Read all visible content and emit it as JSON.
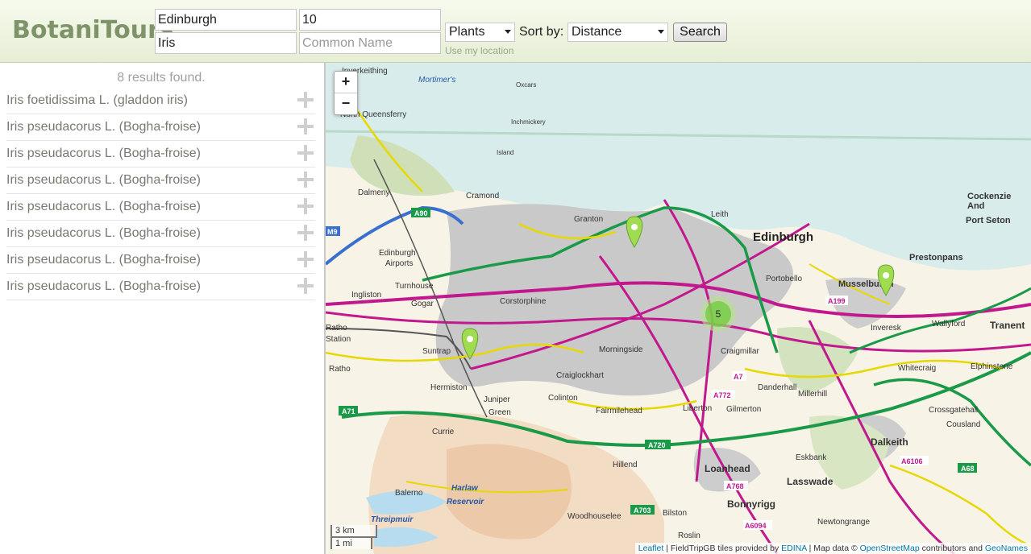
{
  "header": {
    "logo": "BotaniTours",
    "location_value": "Edinburgh",
    "radius_value": "10",
    "species_value": "Iris",
    "common_name_placeholder": "Common Name",
    "category_value": "Plants",
    "sort_label": "Sort by:",
    "sort_value": "Distance",
    "search_label": "Search",
    "use_location_label": "Use my location"
  },
  "results": {
    "count_text": "8 results found.",
    "items": [
      "Iris foetidissima L. (gladdon iris)",
      "Iris pseudacorus L. (Bogha-froise)",
      "Iris pseudacorus L. (Bogha-froise)",
      "Iris pseudacorus L. (Bogha-froise)",
      "Iris pseudacorus L. (Bogha-froise)",
      "Iris pseudacorus L. (Bogha-froise)",
      "Iris pseudacorus L. (Bogha-froise)",
      "Iris pseudacorus L. (Bogha-froise)"
    ]
  },
  "map": {
    "zoom_in": "+",
    "zoom_out": "−",
    "cluster_count": "5",
    "scale_km": "3 km",
    "scale_mi": "1 mi",
    "attribution": {
      "leaflet": "Leaflet",
      "part1": " | FieldTripGB tiles provided by ",
      "edina": "EDINA",
      "part2": " | Map data © ",
      "osm": "OpenStreetMap",
      "part3": " contributors and ",
      "geonames": "GeoNames"
    },
    "place_labels": {
      "inverkeithing": "Inverkeithing",
      "north_queensferry": "North Queensferry",
      "dalmeny": "Dalmeny",
      "cramond": "Cramond",
      "granton": "Granton",
      "leith": "Leith",
      "edinburgh": "Edinburgh",
      "cockenzie": "Cockenzie",
      "and": "And",
      "port_seton": "Port Seton",
      "prestonpans": "Prestonpans",
      "musselburgh": "Musselburgh",
      "edinburgh_airport": "Edinburgh",
      "airports": "Airports",
      "ratho_station": "Ratho",
      "station": "Station",
      "corstorphine": "Corstorphine",
      "morningside": "Morningside",
      "craigmillar": "Craigmillar",
      "craiglockhart": "Craiglockhart",
      "colinton": "Colinton",
      "fairmilehead": "Fairmilehead",
      "liberton": "Liberton",
      "gilmerton": "Gilmerton",
      "dalkeith": "Dalkeith",
      "loanhead": "Loanhead",
      "lasswade": "Lasswade",
      "bonnyrigg": "Bonnyrigg",
      "currie": "Currie",
      "juniper_green": "Juniper",
      "green": "Green",
      "hermiston": "Hermiston",
      "balerno": "Balerno",
      "harlaw_reservoir": "Harlaw",
      "reservoir": "Reservoir",
      "threipmuir": "Threipmuir",
      "wallyford": "Wallyford",
      "whitecraig": "Whitecraig",
      "tranent": "Tranent",
      "elphinstone": "Elphinstone",
      "inveresk": "Inveresk",
      "danderhall": "Danderhall",
      "millerhill": "Millerhill",
      "eskbank": "Eskbank",
      "newtongrange": "Newtongrange",
      "cousland": "Cousland",
      "crossgatehall": "Crossgatehall",
      "hillend": "Hillend",
      "bilston": "Bilston",
      "roslin": "Roslin",
      "woodhouselee": "Woodhouselee",
      "portobello": "Portobello",
      "oxcars": "Oxcars",
      "inchmickery": "Inchmickery",
      "island": "Island",
      "turnhouse": "Turnhouse",
      "ingliston": "Ingliston",
      "gogar": "Gogar",
      "sighthill": "Suntrap",
      "ratho": "Ratho",
      "mortimer": "Mortimer's",
      "a90": "A90",
      "a71": "A71",
      "a720": "A720",
      "a703": "A703",
      "a68": "A68",
      "m9": "M9",
      "a199": "A199",
      "a772": "A772",
      "a768": "A768",
      "a6094": "A6094",
      "a6106": "A6106",
      "a7": "A7"
    }
  }
}
